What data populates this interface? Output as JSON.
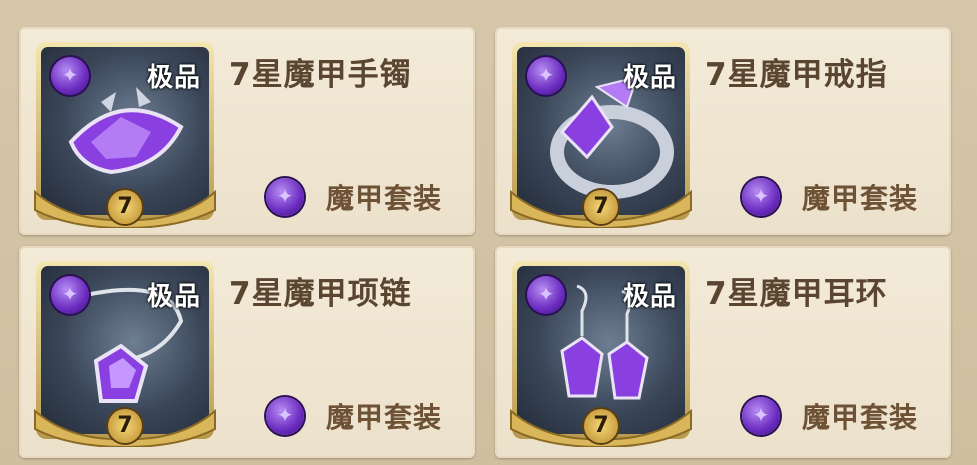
{
  "items": [
    {
      "title": "7星魔甲手镯",
      "grade": "极品",
      "stars": "7",
      "set_label": "魔甲套装",
      "icon": "bracelet-icon"
    },
    {
      "title": "7星魔甲戒指",
      "grade": "极品",
      "stars": "7",
      "set_label": "魔甲套装",
      "icon": "ring-icon"
    },
    {
      "title": "7星魔甲项链",
      "grade": "极品",
      "stars": "7",
      "set_label": "魔甲套装",
      "icon": "necklace-icon"
    },
    {
      "title": "7星魔甲耳环",
      "grade": "极品",
      "stars": "7",
      "set_label": "魔甲套装",
      "icon": "earring-icon"
    }
  ],
  "colors": {
    "card_bg": "#f3ead8",
    "title": "#5a4530",
    "gem_purple": "#8a3fe0",
    "gold": "#d9b65a"
  }
}
